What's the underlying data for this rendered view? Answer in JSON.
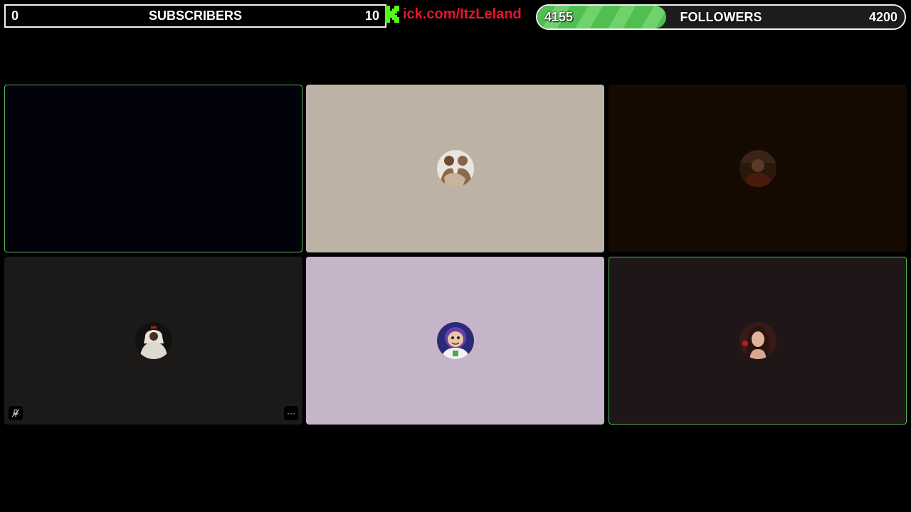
{
  "subscribers": {
    "current": "0",
    "label": "SUBSCRIBERS",
    "goal": "10"
  },
  "kick": {
    "text_parts": [
      "ick.com/",
      "ItzLeland"
    ],
    "colors": {
      "logo": "#53fc18",
      "domain": "#e8142e",
      "name_green": "#53fc18"
    }
  },
  "followers": {
    "current": "4155",
    "label": "FOLLOWERS",
    "goal": "4200",
    "progress": 0.35
  },
  "tiles": [
    {
      "bg": "#02030a",
      "speaking": true,
      "avatar": "none"
    },
    {
      "bg": "#bdb2a6",
      "speaking": false,
      "avatar": "two-people-photo"
    },
    {
      "bg": "#150a02",
      "speaking": false,
      "avatar": "person-dim-photo"
    },
    {
      "bg": "#1c1a19",
      "speaking": false,
      "avatar": "hoodie-person-photo",
      "controls": [
        "mute-icon",
        "more-icon"
      ]
    },
    {
      "bg": "#c6b4c9",
      "speaking": false,
      "avatar": "space-ranger-photo"
    },
    {
      "bg": "#1f1617",
      "speaking": true,
      "avatar": "woman-photo"
    }
  ],
  "icons": {
    "mute": "mute-icon",
    "more": "more-options-icon",
    "more_glyph": "···"
  }
}
